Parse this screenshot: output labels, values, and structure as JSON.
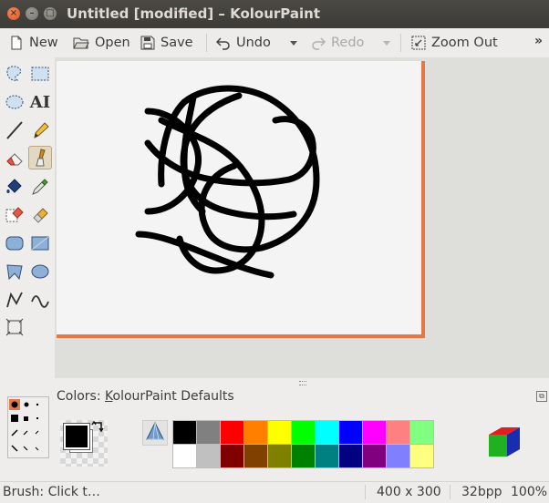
{
  "window": {
    "title": "Untitled [modified] – KolourPaint",
    "close": "×",
    "minimize": "–",
    "maximize": "□"
  },
  "toolbar": {
    "new_label": "New",
    "open_label": "Open",
    "save_label": "Save",
    "undo_label": "Undo",
    "redo_label": "Redo",
    "zoom_out_label": "Zoom Out",
    "more_label": "»"
  },
  "tools": [
    {
      "name": "free-form-selection-tool",
      "icon": "lasso-icon"
    },
    {
      "name": "rectangular-selection-tool",
      "icon": "rect-select-icon"
    },
    {
      "name": "elliptical-selection-tool",
      "icon": "ellipse-select-icon"
    },
    {
      "name": "text-tool",
      "icon": "text-icon",
      "glyph": "AI"
    },
    {
      "name": "line-tool",
      "icon": "line-icon"
    },
    {
      "name": "pen-tool",
      "icon": "pencil-icon"
    },
    {
      "name": "eraser-tool",
      "icon": "eraser-icon"
    },
    {
      "name": "brush-tool",
      "icon": "brush-icon",
      "selected": true
    },
    {
      "name": "flood-fill-tool",
      "icon": "fill-bucket-icon"
    },
    {
      "name": "color-picker-tool",
      "icon": "eyedropper-icon"
    },
    {
      "name": "color-eraser-tool",
      "icon": "color-eraser-icon"
    },
    {
      "name": "spraycan-tool",
      "icon": "spraycan-icon"
    },
    {
      "name": "rounded-rectangle-tool",
      "icon": "rounded-rect-icon"
    },
    {
      "name": "rectangle-tool",
      "icon": "rectangle-icon"
    },
    {
      "name": "polygon-tool",
      "icon": "polygon-icon"
    },
    {
      "name": "ellipse-tool",
      "icon": "ellipse-icon"
    },
    {
      "name": "connected-lines-tool",
      "icon": "polyline-icon"
    },
    {
      "name": "curve-tool",
      "icon": "curve-icon"
    },
    {
      "name": "zoom-tool",
      "icon": "zoom-frame-icon"
    }
  ],
  "colors_panel": {
    "label_prefix": "Colors: ",
    "label_accel": "K",
    "label_rest": "olourPaint Defaults"
  },
  "current_colors": {
    "foreground": "#000000",
    "background": "#ffffff"
  },
  "palette": {
    "row1": [
      "#000000",
      "#808080",
      "#ff0000",
      "#ff8000",
      "#ffff00",
      "#00ff00",
      "#00ffff",
      "#0000ff",
      "#ff00ff",
      "#ff8080",
      "#80ff80"
    ],
    "row2": [
      "#ffffff",
      "#c0c0c0",
      "#800000",
      "#804000",
      "#808000",
      "#008000",
      "#008080",
      "#000080",
      "#800080",
      "#8080ff",
      "#ffff80"
    ]
  },
  "accent": {
    "canvas_border": "#e2774c",
    "selected_tool": "#e3d8c0"
  },
  "status": {
    "message": "Brush: Click t…",
    "dimensions": "400 x 300",
    "depth": "32bpp",
    "zoom": "100%"
  }
}
